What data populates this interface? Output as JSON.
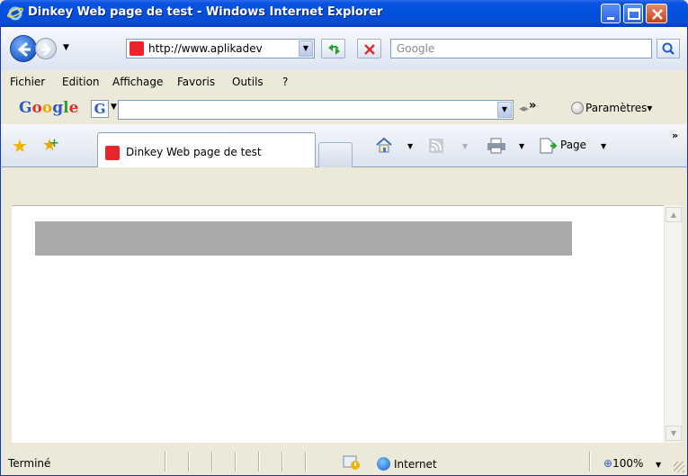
{
  "window": {
    "title": "Dinkey Web page de test - Windows Internet Explorer"
  },
  "address_bar": {
    "url": "http://www.aplikadev",
    "search_placeholder": "Google"
  },
  "menu": {
    "items": [
      "Fichier",
      "Edition",
      "Affichage",
      "Favoris",
      "Outils",
      "?"
    ]
  },
  "google_toolbar": {
    "logo": "Google",
    "icon_letter": "G",
    "more": "»",
    "settings_label": "Paramètres▾"
  },
  "tabs": {
    "active_label": "Dinkey Web page de test",
    "page_menu_label": "Page"
  },
  "status": {
    "text": "Terminé",
    "zone": "Internet",
    "zoom": "100%"
  },
  "colors": {
    "titlebar": "#0050DC",
    "placeholder_block": "#A9A9A9",
    "favicon": "#E8252B"
  }
}
